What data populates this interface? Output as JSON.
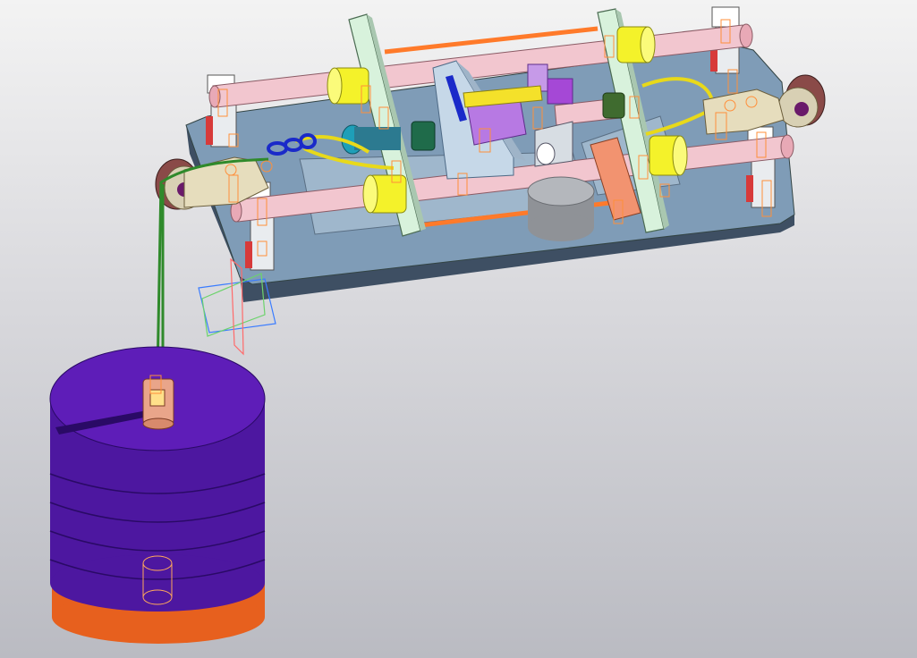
{
  "viewport": {
    "kind": "3d-cad-model-view",
    "background_top": "#f3f3f3",
    "background_bottom": "#babbc2"
  },
  "colors": {
    "base_plate_top": "#7f9cb7",
    "base_plate_side": "#3e4f63",
    "guide_rod": "#f2c6cf",
    "bushing": "#f4f22a",
    "upright_plate": "#d8f2dc",
    "support_block": "#f4f0c8",
    "support_cap": "#ffffff",
    "red_pad": "#d73a3a",
    "purple_part": "#b779e3",
    "weight_stack": "#5c1ab0",
    "weight_base": "#f2722b",
    "cable": "#2f8a2b",
    "fastener_wire": "#ff8f3a",
    "hook": "#1a2ac9",
    "cylinder": "#9fa2a7",
    "pulley": "#8a4a48"
  },
  "icons": [
    "coordinate-triad-icon"
  ]
}
